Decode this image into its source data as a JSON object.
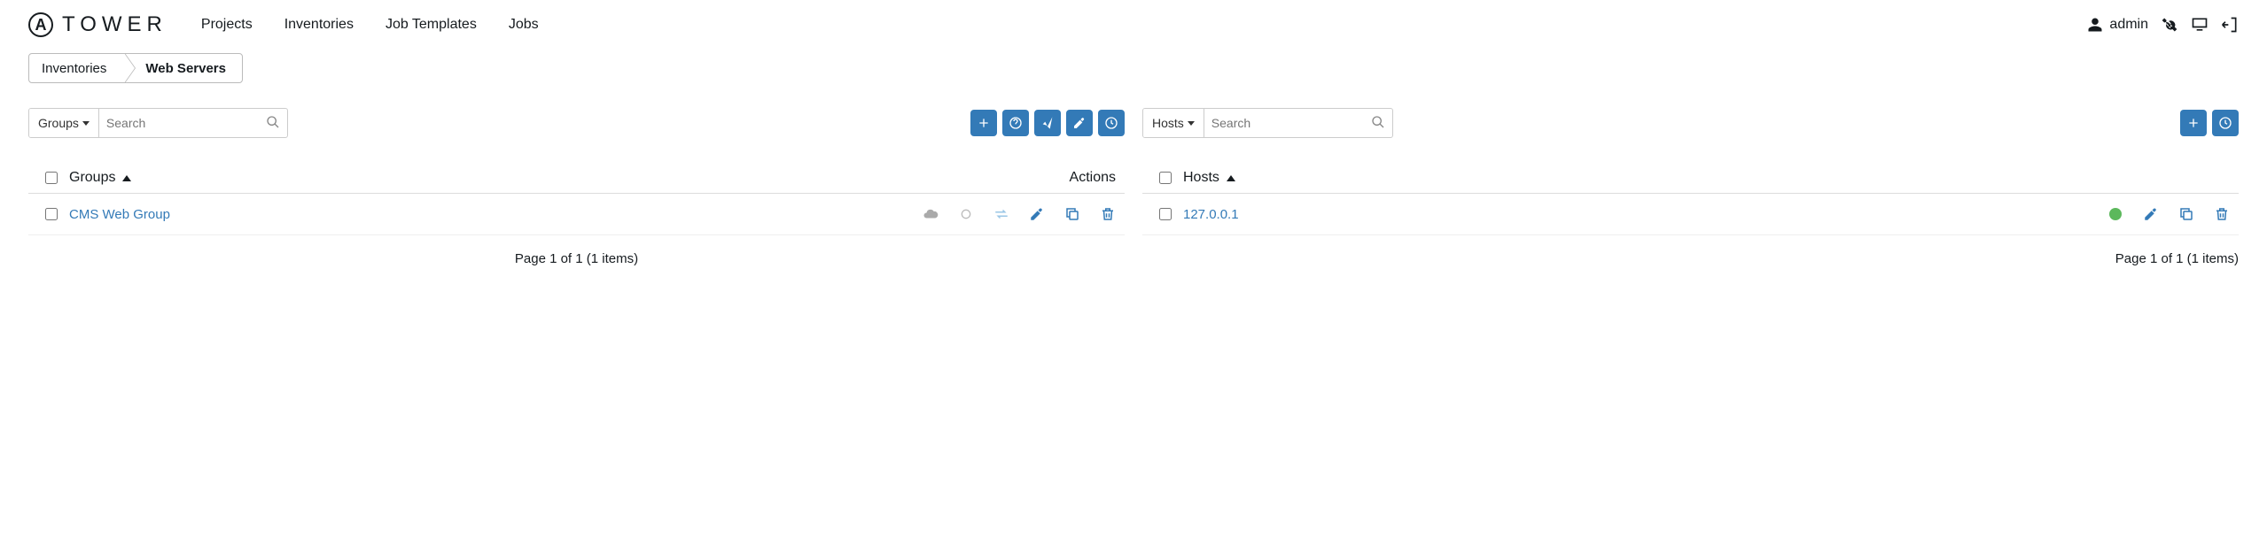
{
  "header": {
    "logo_glyph": "A",
    "logo_text": "TOWER",
    "nav": [
      "Projects",
      "Inventories",
      "Job Templates",
      "Jobs"
    ],
    "user": "admin"
  },
  "breadcrumb": {
    "parent": "Inventories",
    "current": "Web Servers"
  },
  "groups_panel": {
    "filter_label": "Groups",
    "search_placeholder": "Search",
    "header_name": "Groups",
    "header_actions": "Actions",
    "rows": [
      {
        "name": "CMS Web Group"
      }
    ],
    "pager": "Page 1 of 1 (1 items)"
  },
  "hosts_panel": {
    "filter_label": "Hosts",
    "search_placeholder": "Search",
    "header_name": "Hosts",
    "rows": [
      {
        "name": "127.0.0.1"
      }
    ],
    "pager": "Page 1 of 1 (1 items)"
  }
}
